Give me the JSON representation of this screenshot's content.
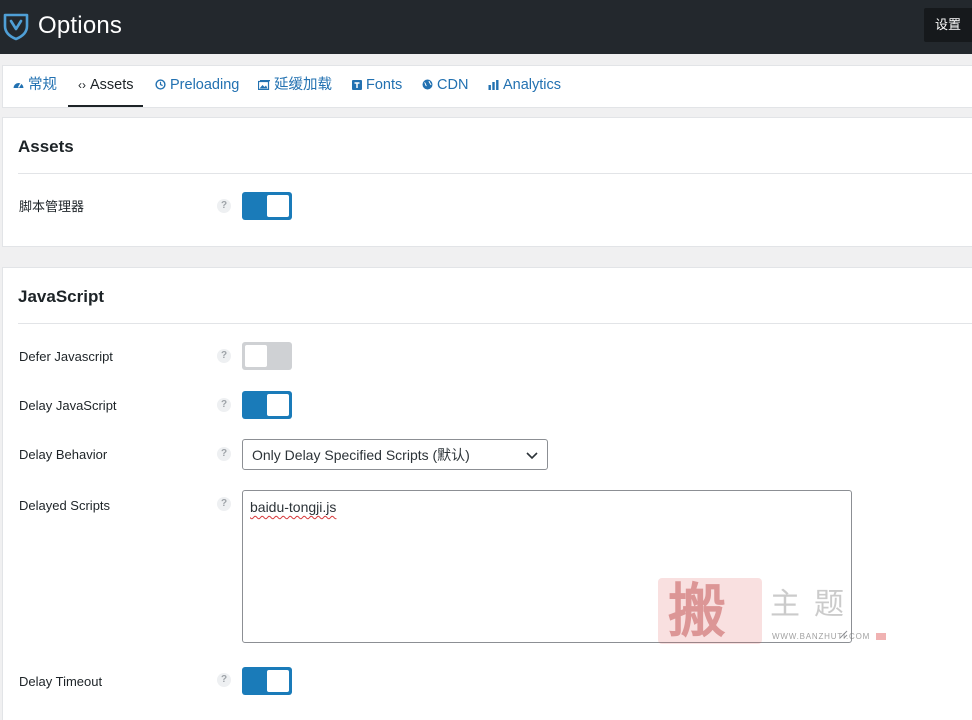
{
  "header": {
    "title": "Options",
    "settings_label": "设置",
    "logo_icon": "perfmatters-logo-icon"
  },
  "tabs": [
    {
      "label": "常规",
      "icon": "dashboard-icon",
      "active": false
    },
    {
      "label": "Assets",
      "icon": "code-icon",
      "active": true
    },
    {
      "label": "Preloading",
      "icon": "clock-icon",
      "active": false
    },
    {
      "label": "延缓加载",
      "icon": "images-icon",
      "active": false
    },
    {
      "label": "Fonts",
      "icon": "font-icon",
      "active": false
    },
    {
      "label": "CDN",
      "icon": "globe-icon",
      "active": false
    },
    {
      "label": "Analytics",
      "icon": "chart-bar-icon",
      "active": false
    }
  ],
  "assets_section": {
    "title": "Assets",
    "rows": [
      {
        "label": "脚本管理器",
        "help": "?",
        "type": "toggle",
        "enabled": true
      }
    ]
  },
  "javascript_section": {
    "title": "JavaScript",
    "defer": {
      "label": "Defer Javascript",
      "help": "?",
      "enabled": false
    },
    "delay": {
      "label": "Delay JavaScript",
      "help": "?",
      "enabled": true
    },
    "behavior": {
      "label": "Delay Behavior",
      "help": "?",
      "selected": "Only Delay Specified Scripts (默认)"
    },
    "scripts": {
      "label": "Delayed Scripts",
      "help": "?",
      "value": "baidu-tongji.js"
    },
    "timeout": {
      "label": "Delay Timeout",
      "help": "?",
      "enabled": true
    }
  },
  "watermark": {
    "big_char": "搬",
    "sub_text": "主题",
    "url": "WWW.BANZHUTI.COM"
  },
  "colors": {
    "header_bg": "#23282d",
    "accent": "#1a7bb9",
    "link": "#2271b1",
    "toggle_off": "#cfd1d4"
  }
}
